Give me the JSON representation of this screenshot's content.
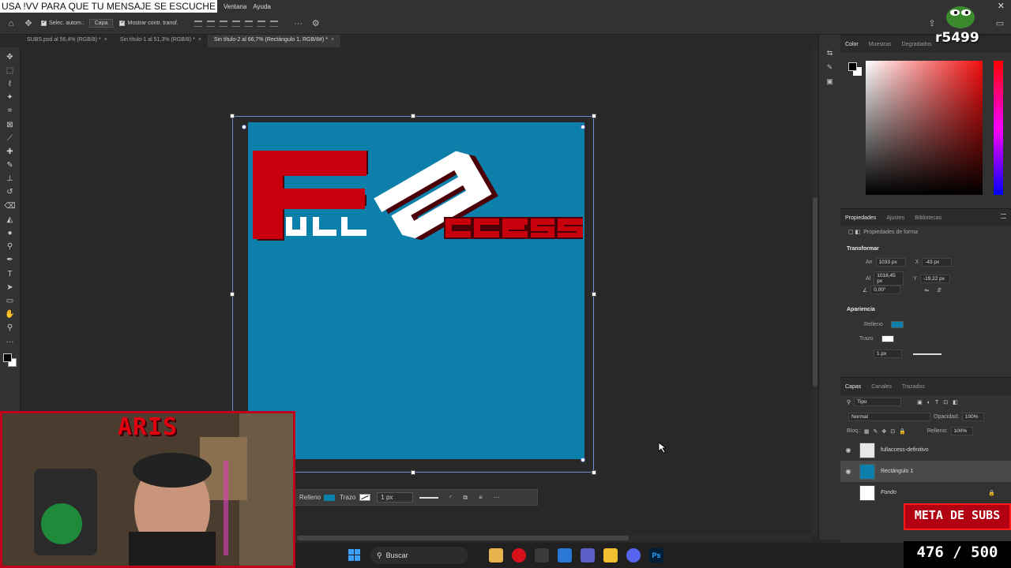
{
  "menubar": {
    "banner": "USA !VV PARA QUE TU MENSAJE SE ESCUCHE",
    "items": [
      "Ventana",
      "Ayuda"
    ],
    "close": "✕"
  },
  "options": {
    "auto_select_label": "Selec. autom.:",
    "auto_select_value": "Capa",
    "show_transform_label": "Mostrar contr. transf.",
    "more": "···"
  },
  "tabs": [
    {
      "label": "SUBS.psd al 56,4% (RGB/8) *"
    },
    {
      "label": "Sin título-1 al 51,3% (RGB/8) *"
    },
    {
      "label": "Sin título-2 al 66,7% (Rectángulo 1, RGB/8#) *"
    }
  ],
  "context_bar": {
    "fill_label": "Relleno",
    "stroke_label": "Trazo",
    "stroke_width": "1 px",
    "more": "···"
  },
  "color_panel": {
    "tabs": [
      "Color",
      "Muestras",
      "Degradados"
    ],
    "active_tab": "Color"
  },
  "properties_panel": {
    "tabs": [
      "Propiedades",
      "Ajustes",
      "Bibliotecas"
    ],
    "subtitle": "Propiedades de forma",
    "transform_title": "Transformar",
    "w_label": "An",
    "w_value": "1033 px",
    "x_label": "X",
    "x_value": "-43 px",
    "h_label": "Al",
    "h_value": "1018,45 px",
    "y_label": "Y",
    "y_value": "-19,22 px",
    "angle_value": "0,00°",
    "appearance_title": "Apariencia",
    "fill_label": "Relleno",
    "stroke_label": "Trazo",
    "stroke_width": "1 px"
  },
  "layers_panel": {
    "tabs": [
      "Capas",
      "Canales",
      "Trazados"
    ],
    "filter": "Tipo",
    "blend_mode": "Normal",
    "opacity_label": "Opacidad:",
    "opacity_value": "100%",
    "lock_label": "Bloq.:",
    "fill_label": "Relleno:",
    "fill_value": "100%",
    "layers": [
      {
        "name": "fullaccess-definitivo",
        "visible": true,
        "selected": false
      },
      {
        "name": "Rectángulo 1",
        "visible": true,
        "selected": true
      },
      {
        "name": "Fondo",
        "visible": false,
        "selected": false
      }
    ]
  },
  "taskbar": {
    "search_placeholder": "Buscar"
  },
  "overlay": {
    "streamer_name": "ARIS",
    "corner_code": "r5499",
    "goal_label": "META DE SUBS",
    "goal_count": "476 / 500"
  },
  "colors": {
    "canvas_blue": "#0c7faa",
    "logo_red": "#c8000d",
    "logo_dark": "#4a0006",
    "overlay_red": "#c0001a"
  }
}
